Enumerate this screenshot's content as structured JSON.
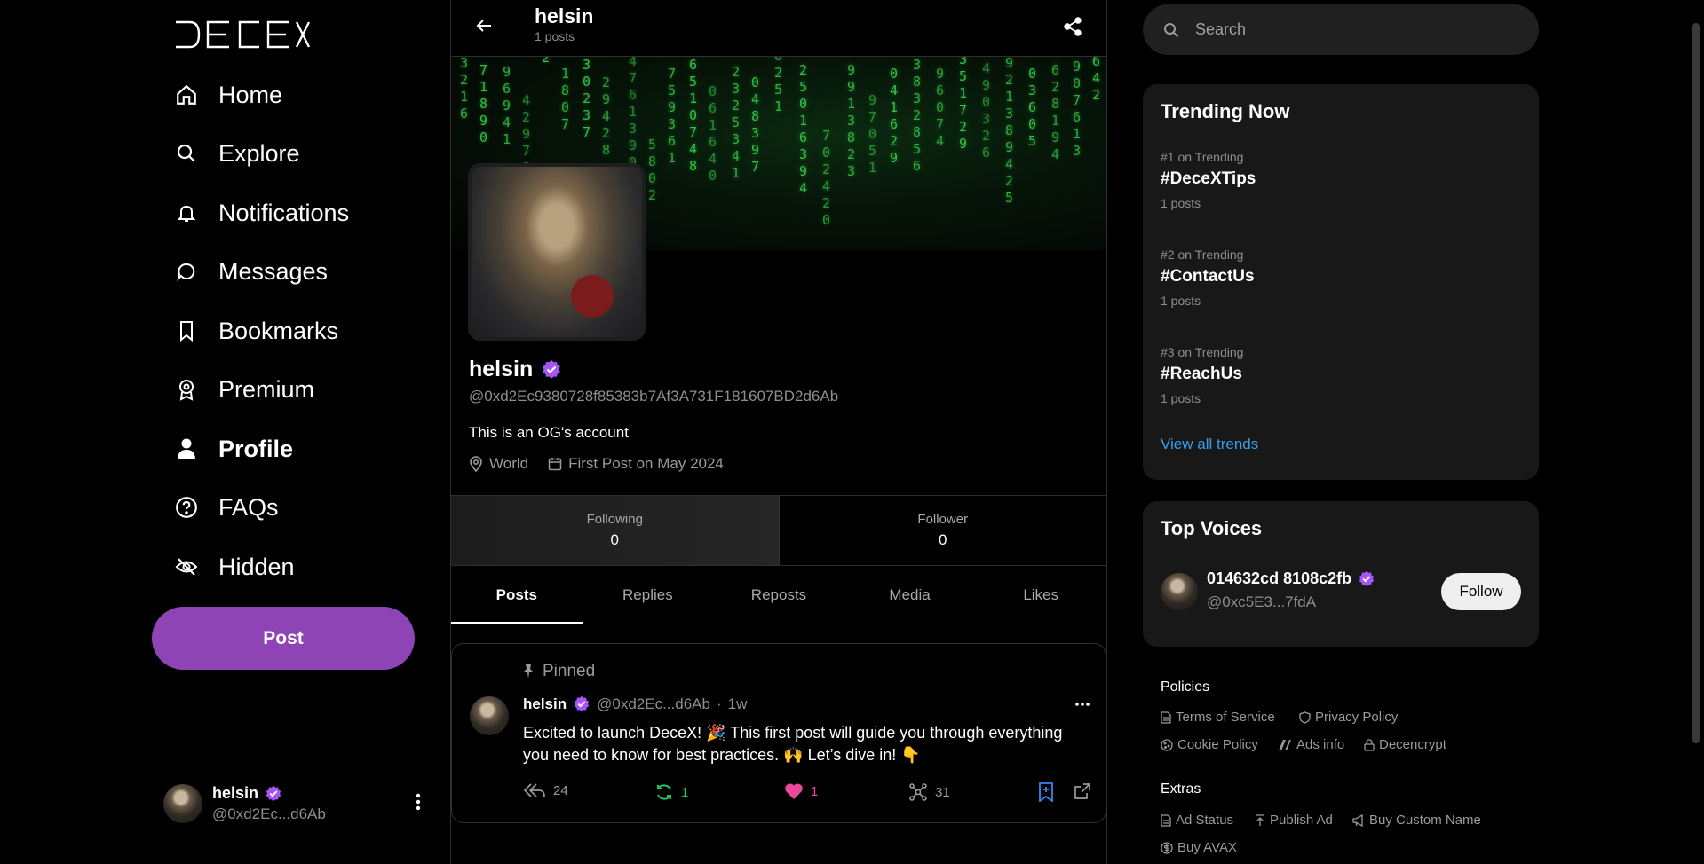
{
  "app": {
    "logo_text": "DECEX"
  },
  "nav": {
    "items": [
      {
        "label": "Home",
        "icon": "home-icon"
      },
      {
        "label": "Explore",
        "icon": "search-icon"
      },
      {
        "label": "Notifications",
        "icon": "bell-icon"
      },
      {
        "label": "Messages",
        "icon": "chat-icon"
      },
      {
        "label": "Bookmarks",
        "icon": "bookmark-icon"
      },
      {
        "label": "Premium",
        "icon": "award-icon"
      },
      {
        "label": "Profile",
        "icon": "user-icon",
        "active": true
      },
      {
        "label": "FAQs",
        "icon": "question-icon"
      },
      {
        "label": "Hidden",
        "icon": "eye-off-icon"
      }
    ],
    "post_label": "Post"
  },
  "current_user": {
    "name": "helsin",
    "handle": "@0xd2Ec...d6Ab",
    "verified": true
  },
  "topbar": {
    "title": "helsin",
    "subtitle": "1 posts"
  },
  "profile": {
    "name": "helsin",
    "verified": true,
    "address": "@0xd2Ec9380728f85383b7Af3A731F181607BD2d6Ab",
    "bio": "This is an OG's account",
    "location": "World",
    "first_post": "First Post on May 2024",
    "following_label": "Following",
    "following_count": "0",
    "follower_label": "Follower",
    "follower_count": "0"
  },
  "tabs": [
    "Posts",
    "Replies",
    "Reposts",
    "Media",
    "Likes"
  ],
  "active_tab": "Posts",
  "pinned_post": {
    "pinned_label": "Pinned",
    "author": "helsin",
    "handle": "@0xd2Ec...d6Ab",
    "time": "1w",
    "text": "Excited to launch DeceX! 🎉 This first post will guide you through everything you need to know for best practices. 🙌 Let’s dive in! 👇",
    "replies": "24",
    "reposts": "1",
    "likes": "1",
    "views": "31"
  },
  "search": {
    "placeholder": "Search"
  },
  "trending": {
    "title": "Trending Now",
    "items": [
      {
        "rank": "#1 on Trending",
        "tag": "#DeceXTips",
        "count": "1 posts"
      },
      {
        "rank": "#2 on Trending",
        "tag": "#ContactUs",
        "count": "1 posts"
      },
      {
        "rank": "#3 on Trending",
        "tag": "#ReachUs",
        "count": "1 posts"
      }
    ],
    "view_all": "View all trends"
  },
  "top_voices": {
    "title": "Top Voices",
    "user": {
      "name": "014632cd 8108c2fb",
      "handle": "@0xc5E3...7fdA",
      "verified": true
    },
    "follow_label": "Follow"
  },
  "footer": {
    "policies_label": "Policies",
    "policies": [
      {
        "label": "Terms of Service",
        "icon": "document-icon"
      },
      {
        "label": "Privacy Policy",
        "icon": "shield-icon"
      },
      {
        "label": "Cookie Policy",
        "icon": "cookie-icon"
      },
      {
        "label": "Ads info",
        "icon": "ads-icon"
      },
      {
        "label": "Decencrypt",
        "icon": "lock-icon"
      }
    ],
    "extras_label": "Extras",
    "extras": [
      {
        "label": "Ad Status",
        "icon": "document-icon"
      },
      {
        "label": "Publish Ad",
        "icon": "publish-icon"
      },
      {
        "label": "Buy Custom Name",
        "icon": "megaphone-icon"
      },
      {
        "label": "Buy AVAX",
        "icon": "coin-icon"
      }
    ]
  },
  "colors": {
    "accent": "#8e44b5",
    "verified": "#a855f7",
    "link": "#3b9de8",
    "repost": "#22c55e",
    "like": "#ec4899",
    "bookmark": "#3b82f6",
    "matrix": "#3dcf52"
  }
}
